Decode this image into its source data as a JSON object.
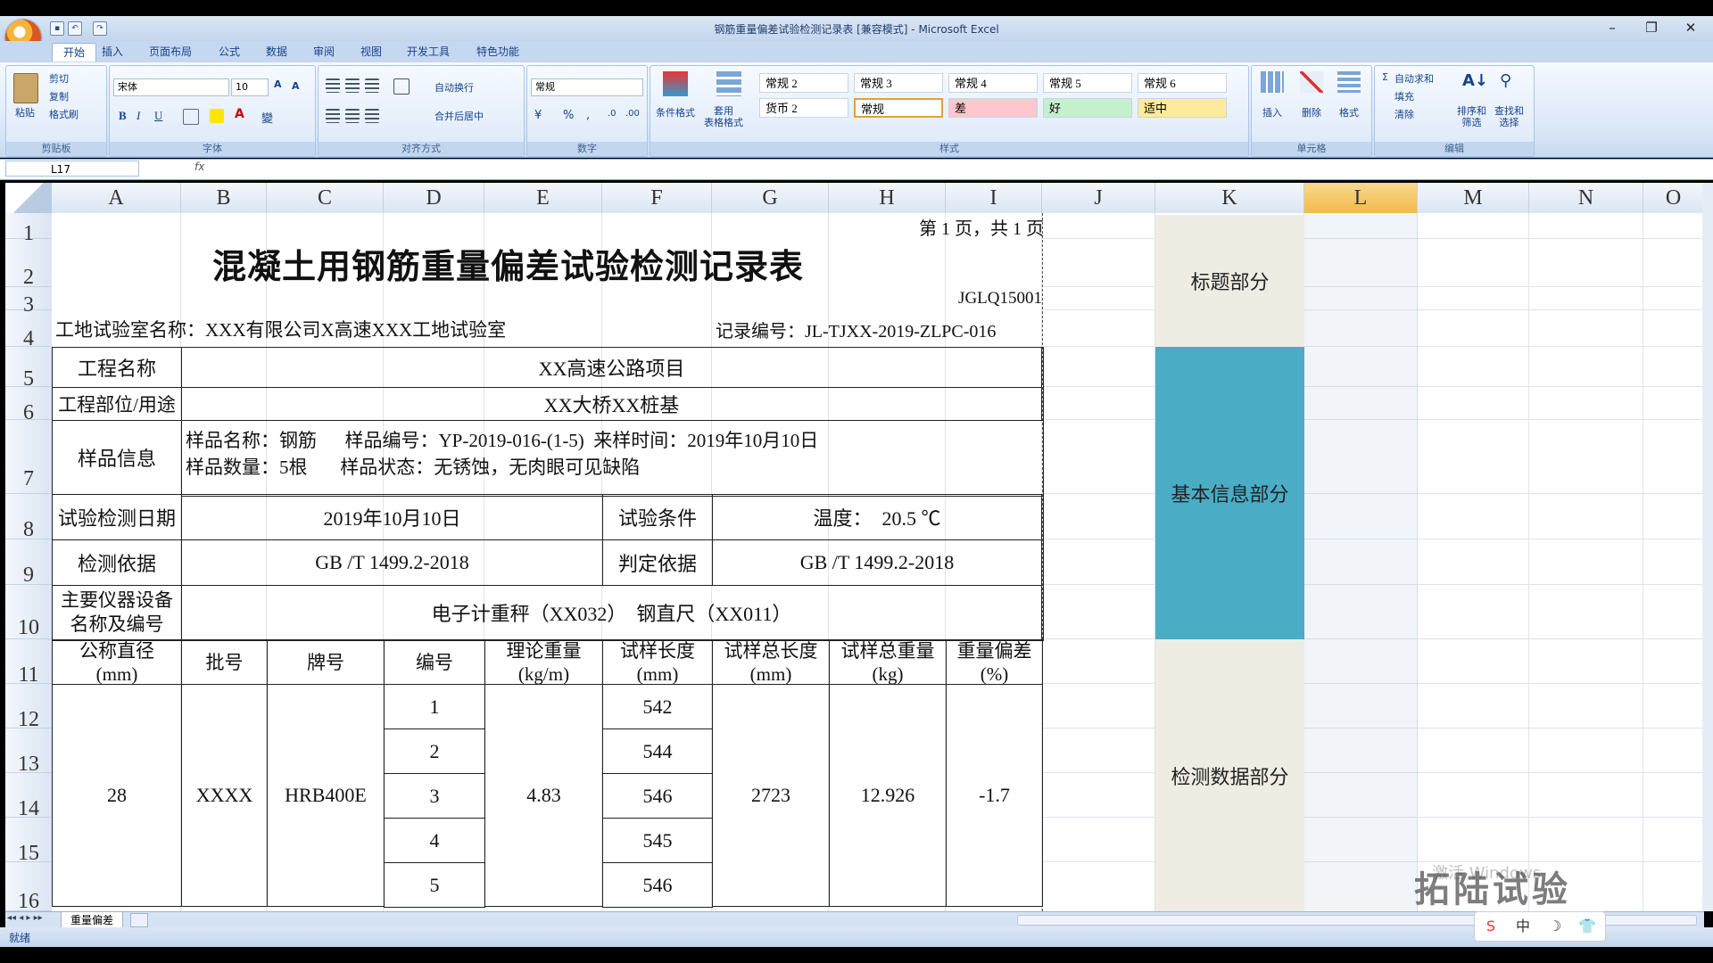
{
  "window": {
    "title": "钢筋重量偏差试验检测记录表 [兼容模式] - Microsoft Excel",
    "min": "–",
    "restore": "❐",
    "close": "✕"
  },
  "tabs": [
    "开始",
    "插入",
    "页面布局",
    "公式",
    "数据",
    "审阅",
    "视图",
    "开发工具",
    "特色功能"
  ],
  "ribbon": {
    "clipboard": {
      "label": "剪贴板",
      "paste": "粘贴",
      "cut": "剪切",
      "copy": "复制",
      "format_painter": "格式刷"
    },
    "font": {
      "label": "字体",
      "name": "宋体",
      "size": "10"
    },
    "alignment": {
      "label": "对齐方式",
      "wrap": "自动换行",
      "merge": "合并后居中"
    },
    "number": {
      "label": "数字",
      "format": "常规"
    },
    "styles": {
      "label": "样式",
      "cond_format": "条件格式",
      "table_format": "套用\n表格格式",
      "cells": [
        {
          "text": "常规 2",
          "bg": "#ffffff"
        },
        {
          "text": "常规 3",
          "bg": "#ffffff"
        },
        {
          "text": "常规 4",
          "bg": "#ffffff"
        },
        {
          "text": "常规 5",
          "bg": "#ffffff"
        },
        {
          "text": "常规 6",
          "bg": "#ffffff"
        },
        {
          "text": "货币 2",
          "bg": "#ffffff"
        },
        {
          "text": "常规",
          "bg": "#ffffff"
        },
        {
          "text": "差",
          "bg": "#ffc7ce"
        },
        {
          "text": "好",
          "bg": "#c6efce"
        },
        {
          "text": "适中",
          "bg": "#ffeb9c"
        }
      ]
    },
    "cells_group": {
      "label": "单元格",
      "insert": "插入",
      "delete": "删除",
      "format": "格式"
    },
    "editing": {
      "label": "编辑",
      "autosum": "自动求和",
      "fill": "填充",
      "clear": "清除",
      "sort": "排序和\n筛选",
      "find": "查找和\n选择"
    }
  },
  "formula_bar": {
    "name_box": "L17",
    "fx": "fx"
  },
  "columns": [
    "A",
    "B",
    "C",
    "D",
    "E",
    "F",
    "G",
    "H",
    "I",
    "J",
    "K",
    "L",
    "M",
    "N",
    "O"
  ],
  "rows": [
    "1",
    "2",
    "3",
    "4",
    "5",
    "6",
    "7",
    "8",
    "9",
    "10",
    "11",
    "12",
    "13",
    "14",
    "15",
    "16"
  ],
  "form": {
    "page": "第 1 页，共 1 页",
    "title": "混凝土用钢筋重量偏差试验检测记录表",
    "code": "JGLQ15001",
    "lab_name": "工地试验室名称：XXX有限公司X高速XXX工地试验室",
    "record_no": "记录编号：JL-TJXX-2019-ZLPC-016",
    "project_label": "工程名称",
    "project_value": "XX高速公路项目",
    "part_label": "工程部位/用途",
    "part_value": "XX大桥XX桩基",
    "sample_label": "样品信息",
    "sample_line1": "样品名称：钢筋      样品编号：YP-2019-016-(1-5)  来样时间：2019年10月10日",
    "sample_line2": "样品数量：5根       样品状态：无锈蚀，无肉眼可见缺陷",
    "date_label": "试验检测日期",
    "date_value": "2019年10月10日",
    "cond_label": "试验条件",
    "cond_value": "温度：  20.5 ℃",
    "basis_label": "检测依据",
    "basis_value": "GB /T 1499.2-2018",
    "judge_label": "判定依据",
    "judge_value": "GB /T 1499.2-2018",
    "equip_label": "主要仪器设备\n名称及编号",
    "equip_value": "电子计重秤（XX032）  钢直尺（XX011）",
    "headers": [
      "公称直径\n(mm)",
      "批号",
      "牌号",
      "编号",
      "理论重量\n(kg/m)",
      "试样长度\n(mm)",
      "试样总长度\n(mm)",
      "试样总重量\n(kg)",
      "重量偏差\n(%)"
    ],
    "diameter": "28",
    "batch": "XXXX",
    "grade": "HRB400E",
    "numbers": [
      "1",
      "2",
      "3",
      "4",
      "5"
    ],
    "theory_weight": "4.83",
    "lengths": [
      "542",
      "544",
      "546",
      "545",
      "546"
    ],
    "total_length": "2723",
    "total_weight": "12.926",
    "deviation": "-1.7"
  },
  "side_labels": {
    "title": "标题部分",
    "basic": "基本信息部分",
    "data": "检测数据部分",
    "colors": {
      "beige": "#efece3",
      "teal": "#4bacc6"
    }
  },
  "sheet_tab": "重量偏差",
  "status": {
    "ready": "就绪"
  },
  "watermark": {
    "activate": "激活 Windows",
    "brand": "拓陆试验"
  },
  "ime": [
    "S",
    "中",
    "☽",
    "👕"
  ]
}
